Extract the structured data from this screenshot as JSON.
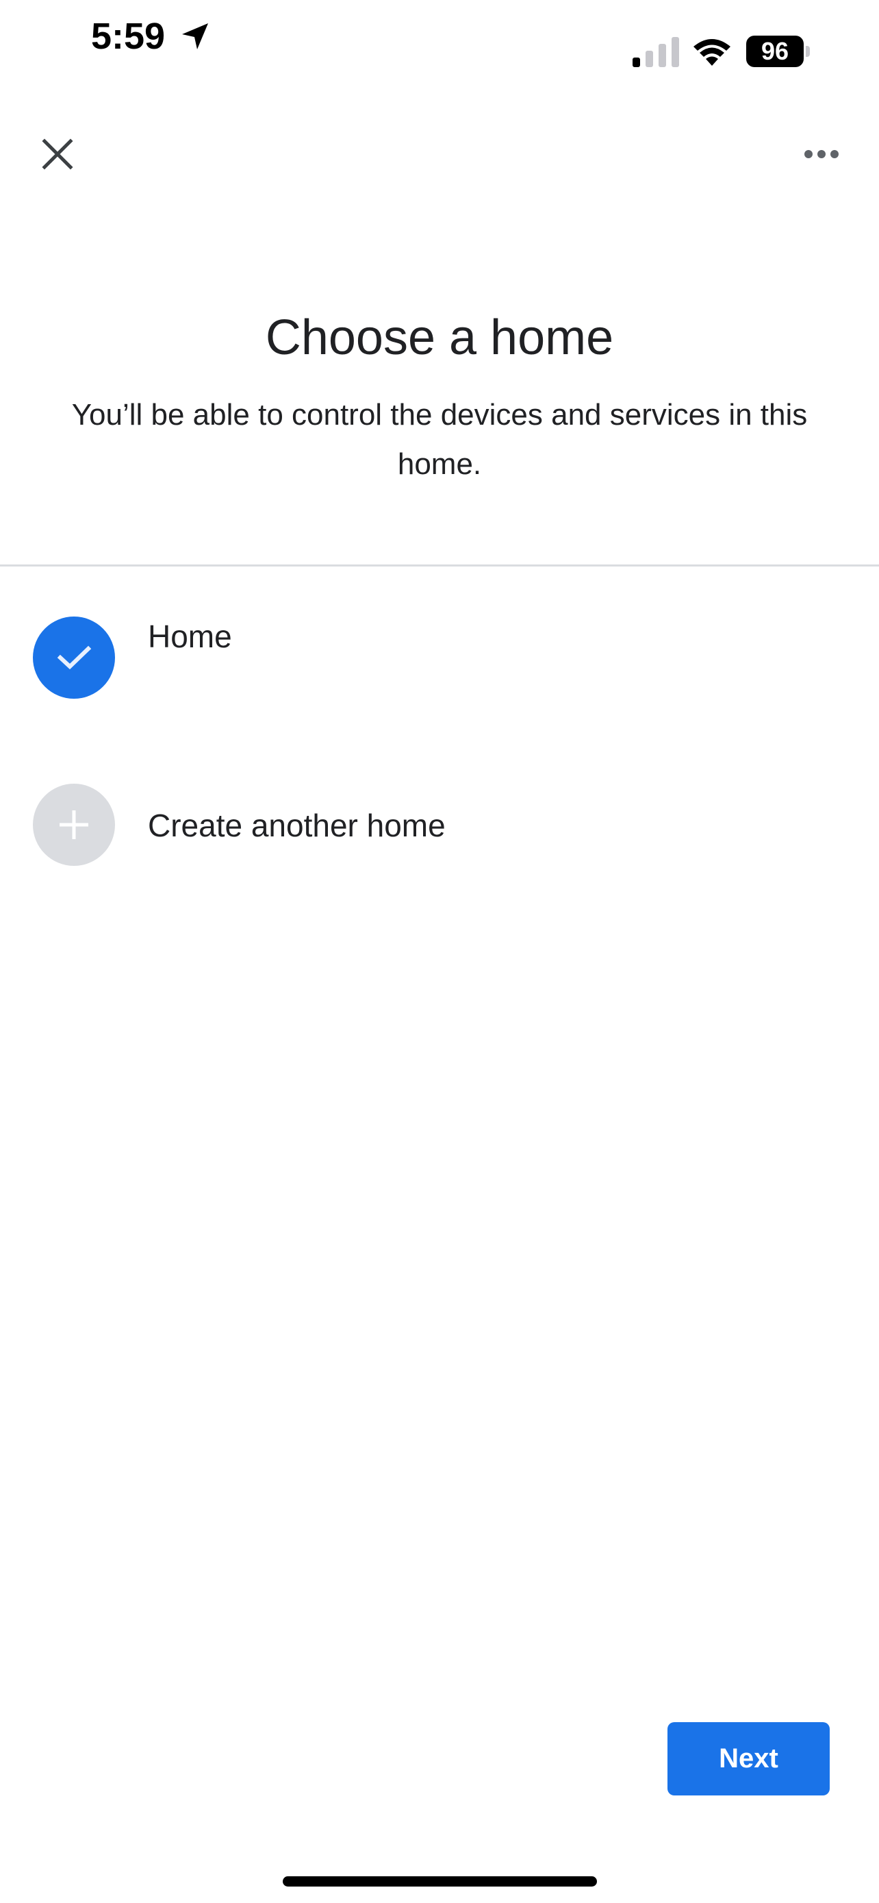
{
  "status_bar": {
    "time": "5:59",
    "location_icon": "location-arrow-icon",
    "signal_bars_active": 1,
    "signal_bars_total": 4,
    "wifi_icon": "wifi-icon",
    "battery_level": "96"
  },
  "app_bar": {
    "close_icon": "close-icon",
    "more_icon": "more-horizontal-icon"
  },
  "header": {
    "title": "Choose a home",
    "subtitle": "You’ll be able to control the devices and services in this home."
  },
  "homes": [
    {
      "label": "Home",
      "selected": true,
      "icon": "check-icon"
    },
    {
      "label": "Create another home",
      "selected": false,
      "icon": "plus-icon"
    }
  ],
  "footer": {
    "next_label": "Next"
  },
  "colors": {
    "accent": "#1a73e8",
    "text": "#202124",
    "divider": "#dadce0",
    "unselected_circle": "#dadce0"
  }
}
